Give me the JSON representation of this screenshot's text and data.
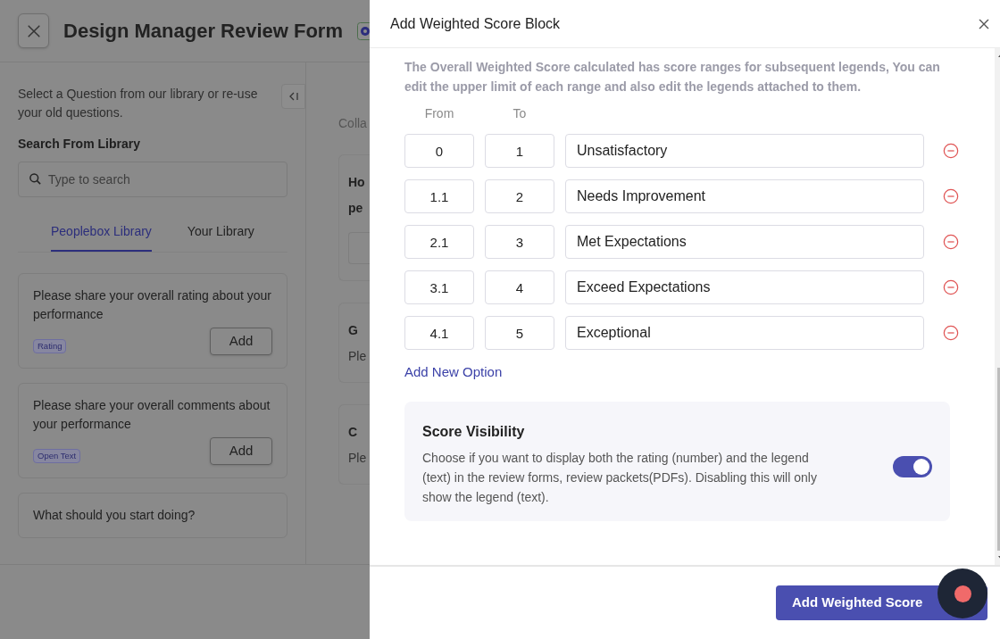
{
  "page": {
    "title": "Design Manager Review Form"
  },
  "library_panel": {
    "intro": "Select a Question from our library or re-use your old questions.",
    "search_label": "Search From Library",
    "search_placeholder": "Type to search",
    "tabs": [
      {
        "label": "Peoplebox Library",
        "selected": true
      },
      {
        "label": "Your Library",
        "selected": false
      }
    ],
    "questions": [
      {
        "text": "Please share your overall rating about your performance",
        "tag": "Rating",
        "button": "Add"
      },
      {
        "text": "Please share your overall comments about your performance",
        "tag": "Open Text",
        "button": "Add"
      },
      {
        "text": "What should you start doing?"
      }
    ]
  },
  "form_preview": {
    "section_label": "Colla",
    "cards": [
      {
        "kind": "field",
        "heading": [
          "Ho",
          "pe"
        ]
      },
      {
        "kind": "text",
        "heading": [
          "G"
        ],
        "body": "Ple"
      },
      {
        "kind": "text",
        "heading": [
          "C"
        ],
        "body": "Ple"
      }
    ]
  },
  "drawer": {
    "title": "Add Weighted Score Block",
    "description": "The Overall Weighted Score calculated has score ranges for subsequent legends, You can edit the upper limit of each range and also edit the legends attached to them.",
    "from_label": "From",
    "to_label": "To",
    "ranges": [
      {
        "from": "0",
        "to": "1",
        "legend": "Unsatisfactory"
      },
      {
        "from": "1.1",
        "to": "2",
        "legend": "Needs Improvement"
      },
      {
        "from": "2.1",
        "to": "3",
        "legend": "Met Expectations"
      },
      {
        "from": "3.1",
        "to": "4",
        "legend": "Exceed Expectations"
      },
      {
        "from": "4.1",
        "to": "5",
        "legend": "Exceptional"
      }
    ],
    "add_option": "Add New Option",
    "visibility": {
      "title": "Score Visibility",
      "text": "Choose if you want to display both the rating (number) and the legend (text) in the review forms, review packets(PDFs). Disabling this will only show the legend (text).",
      "on": true
    },
    "submit": "Add Weighted Score"
  }
}
